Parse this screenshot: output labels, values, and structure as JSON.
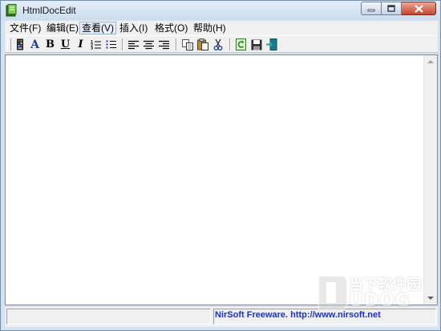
{
  "window": {
    "title": "HtmlDocEdit"
  },
  "menubar": {
    "items": [
      {
        "label": "文件(F)"
      },
      {
        "label": "编辑(E)"
      },
      {
        "label": "查看(V)"
      },
      {
        "label": "插入(I)"
      },
      {
        "label": "格式(O)"
      },
      {
        "label": "帮助(H)"
      }
    ]
  },
  "toolbar": {
    "font_glyph": "A",
    "bold_glyph": "B",
    "underline_glyph": "U",
    "italic_glyph": "I"
  },
  "statusbar": {
    "text": "NirSoft Freeware.  http://www.nirsoft.net"
  },
  "watermark": {
    "cn": "当下软件园",
    "en": "UDOG"
  },
  "colors": {
    "status_link": "#1b30c7",
    "title_bar": "#d3e1f0"
  }
}
